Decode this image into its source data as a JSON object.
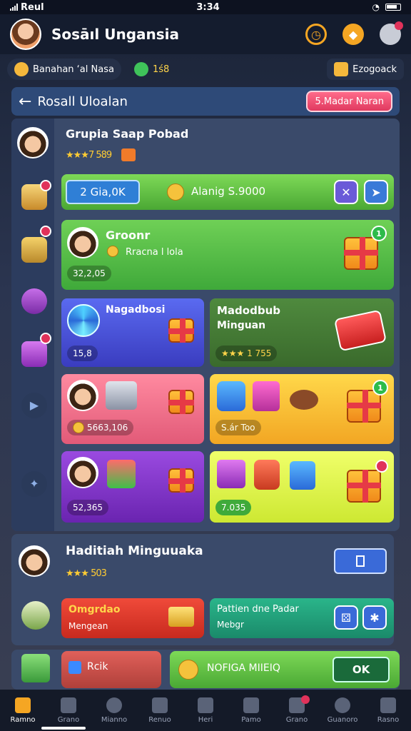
{
  "status": {
    "carrier": "Reul",
    "time": "3:34"
  },
  "header": {
    "title": "Sosāıl Ungansia"
  },
  "subbar": {
    "left_chip": "Banahan  ‘al Nasa",
    "coins": "1ś8",
    "right_chip": "Ezogoack"
  },
  "panel": {
    "back_icon": "←",
    "title": "Rosall Uloalan",
    "action_label": "5.Madar Naran"
  },
  "profile": {
    "name": "Grupia Saap Pobad",
    "rating": "★★★7 589"
  },
  "group_bar": {
    "tag": "2 Gia,0K",
    "center": "Alanig S.9000"
  },
  "card_green": {
    "title": "Groonr",
    "subtitle": "Rracna l lola",
    "value": "32,2,05",
    "badge": "1"
  },
  "card_blue": {
    "title": "Nagadbosi",
    "value": "15,8"
  },
  "card_darkgreen": {
    "title": "Madodbub",
    "subtitle": "Minguan",
    "value": "★★★ 1 755"
  },
  "card_pink": {
    "value": "5663,106"
  },
  "card_yellow": {
    "value": "S.ár Too",
    "badge": "1"
  },
  "card_purple": {
    "value": "52,365"
  },
  "card_lime": {
    "value": "7.035"
  },
  "weekly": {
    "title": "Haditiah Minguuaka",
    "rating": "★★★ 503"
  },
  "weekly_red": {
    "title": "Omgrdao",
    "subtitle": "Mengean"
  },
  "weekly_teal": {
    "title": "Pattien dne Padar",
    "subtitle": "Mebgr"
  },
  "bottom_cards": {
    "left": "Rcik",
    "right": "NOFIGA MIIEIQ",
    "right_btn": "OK"
  },
  "nav": [
    {
      "label": "Ramno"
    },
    {
      "label": "Grano"
    },
    {
      "label": "Mianno"
    },
    {
      "label": "Renuo"
    },
    {
      "label": "Heri"
    },
    {
      "label": "Pamo"
    },
    {
      "label": "Grano"
    },
    {
      "label": "Guanoro"
    },
    {
      "label": "Rasno"
    }
  ]
}
